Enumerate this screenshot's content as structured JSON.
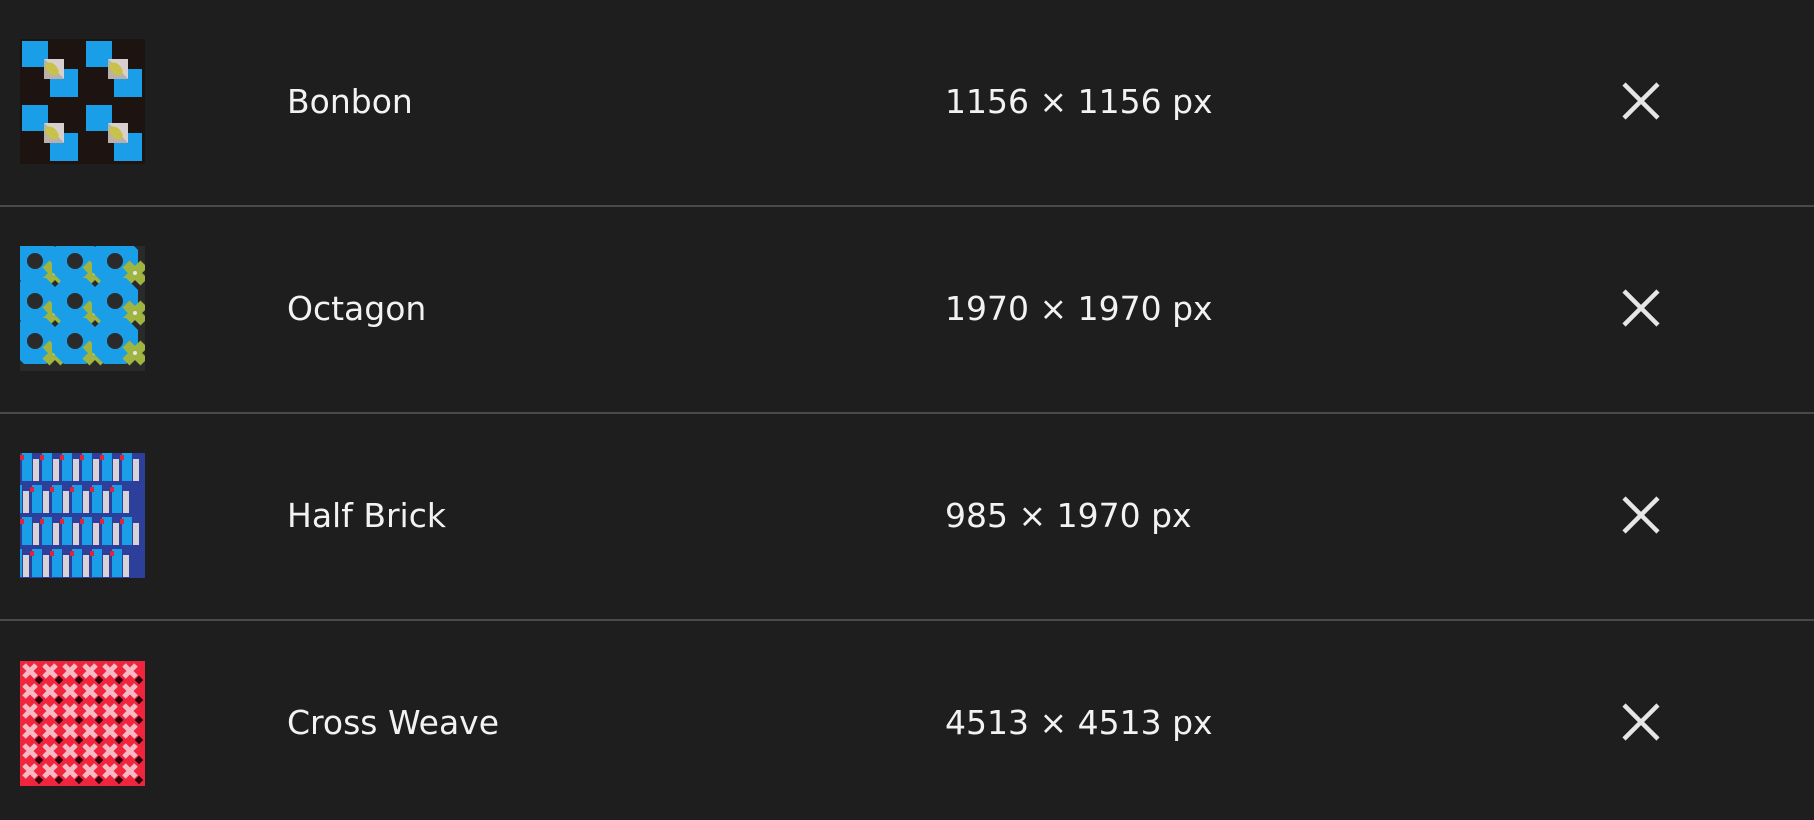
{
  "patterns": [
    {
      "name": "Bonbon",
      "dimensions": "1156 × 1156 px",
      "thumbnail_icon": "bonbon-pattern-icon"
    },
    {
      "name": "Octagon",
      "dimensions": "1970 × 1970 px",
      "thumbnail_icon": "octagon-pattern-icon"
    },
    {
      "name": "Half Brick",
      "dimensions": "985 × 1970 px",
      "thumbnail_icon": "half-brick-pattern-icon"
    },
    {
      "name": "Cross Weave",
      "dimensions": "4513 × 4513 px",
      "thumbnail_icon": "cross-weave-pattern-icon"
    }
  ],
  "remove_icon": "close-icon",
  "colors": {
    "background": "#1e1e1e",
    "divider": "#4a4a4a",
    "text": "#f2f2f2",
    "icon": "#e6e6e6",
    "accent_blue": "#1a9ee8",
    "accent_olive": "#9fb441",
    "accent_red": "#f0243d"
  }
}
